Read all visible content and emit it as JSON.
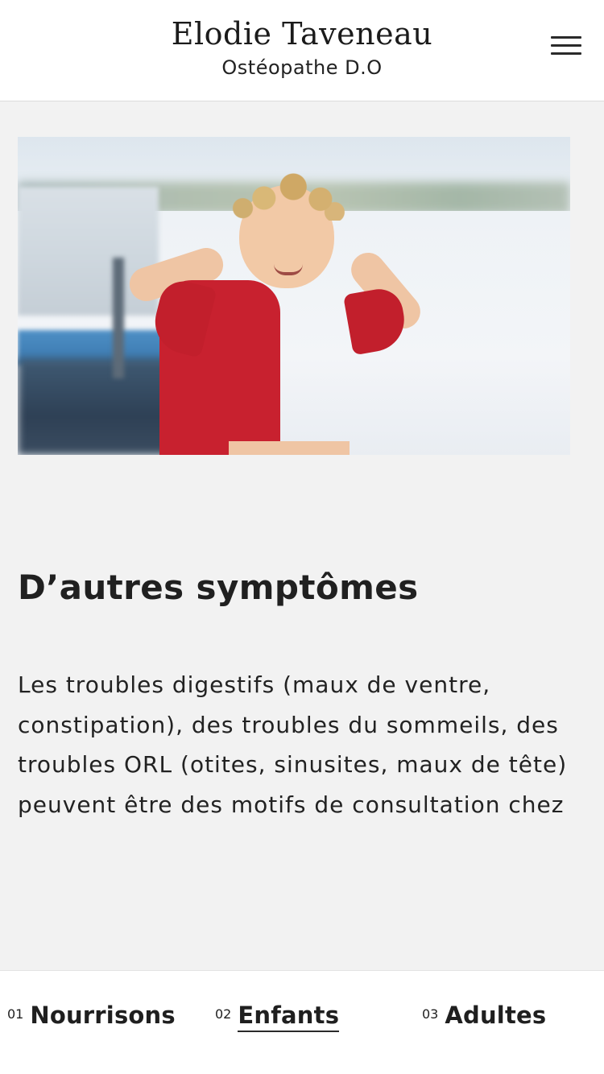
{
  "header": {
    "name": "Elodie Taveneau",
    "subtitle": "Ostéopathe D.O",
    "menu_icon": "hamburger-menu-icon"
  },
  "hero": {
    "image_subject": "child-flexing-arms-red-shirt"
  },
  "content": {
    "title": "D’autres symptômes",
    "body": "Les troubles digestifs (maux de ventre, constipation), des troubles du sommeils, des troubles ORL (otites, sinusites, maux de tête) peuvent être des motifs de consultation chez"
  },
  "tabs": [
    {
      "num": "01",
      "label": "Nourrisons",
      "active": false
    },
    {
      "num": "02",
      "label": "Enfants",
      "active": true
    },
    {
      "num": "03",
      "label": "Adultes",
      "active": false
    }
  ],
  "colors": {
    "background": "#f2f2f2",
    "header_bg": "#ffffff",
    "text": "#1f1f1f",
    "shirt_red": "#c8212f"
  }
}
